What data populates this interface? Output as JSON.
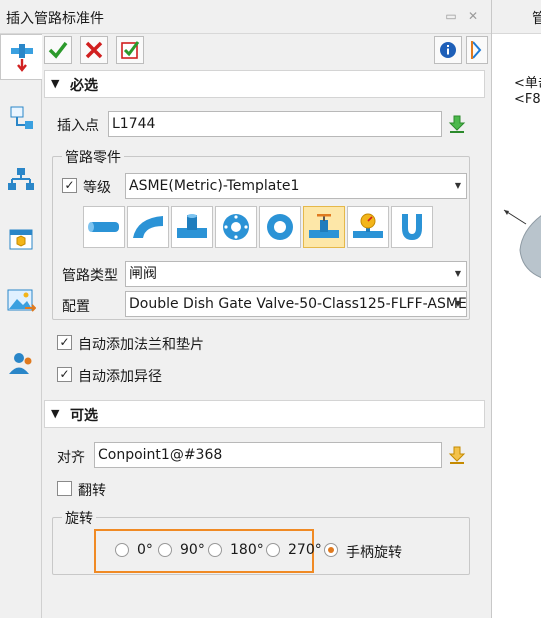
{
  "window": {
    "title": "插入管路标准件",
    "right_tab": "管"
  },
  "right_hints": [
    "<单击",
    "<F8>"
  ],
  "toolbar": {
    "ok_icon": "check-icon",
    "cancel_icon": "x-icon",
    "apply_icon": "apply-icon"
  },
  "required": {
    "header": "必选",
    "insert_point_label": "插入点",
    "insert_point_value": "L1744",
    "group_title": "管路零件",
    "grade_label": "等级",
    "grade_checked": true,
    "grade_value": "ASME(Metric)-Template1",
    "pipe_types": [
      "pipe",
      "elbow",
      "tee",
      "flange",
      "gasket",
      "valve",
      "instrument",
      "u-bend"
    ],
    "selected_type": "valve",
    "pipe_type_label": "管路类型",
    "pipe_type_value": "闸阀",
    "config_label": "配置",
    "config_value": "Double Dish Gate Valve-50-Class125-FLFF-ASME",
    "auto_flange_label": "自动添加法兰和垫片",
    "auto_flange_checked": true,
    "auto_reducer_label": "自动添加异径",
    "auto_reducer_checked": true
  },
  "optional": {
    "header": "可选",
    "align_label": "对齐",
    "align_value": "Conpoint1@#368",
    "flip_label": "翻转",
    "flip_checked": false,
    "rotate_group_title": "旋转",
    "rotations": [
      "0°",
      "90°",
      "180°",
      "270°"
    ],
    "handle_rotate_label": "手柄旋转",
    "selected_rotation": "手柄旋转"
  },
  "colors": {
    "highlight": "#f08a24",
    "accent": "#1e7ad6",
    "ok": "#2c9a2c",
    "cancel": "#d11f1f"
  }
}
